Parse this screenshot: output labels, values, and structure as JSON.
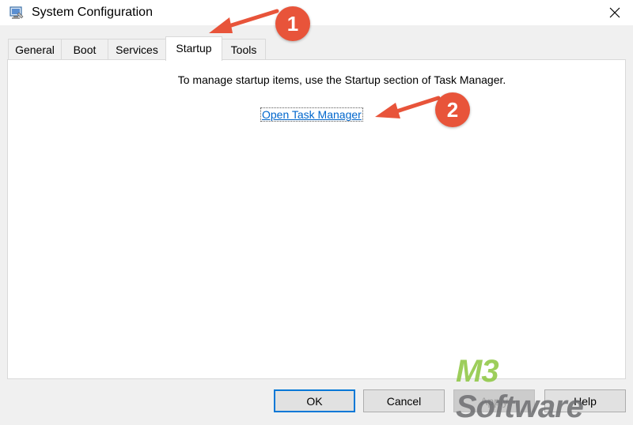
{
  "window": {
    "title": "System Configuration",
    "app_icon": "msconfig-icon",
    "close_icon": "close-icon"
  },
  "tabs": [
    {
      "label": "General",
      "active": false
    },
    {
      "label": "Boot",
      "active": false
    },
    {
      "label": "Services",
      "active": false
    },
    {
      "label": "Startup",
      "active": true
    },
    {
      "label": "Tools",
      "active": false
    }
  ],
  "startup": {
    "info_text": "To manage startup items, use the Startup section of Task Manager.",
    "link_text": "Open Task Manager"
  },
  "buttons": {
    "ok": "OK",
    "cancel": "Cancel",
    "apply": "Apply",
    "help": "Help"
  },
  "watermark": {
    "brand_a": "M3",
    "brand_b": " Software"
  },
  "annotations": {
    "badge_1": "1",
    "badge_2": "2",
    "color": "#e8543a"
  },
  "colors": {
    "link": "#0066cc",
    "default_button_border": "#0078d7",
    "watermark_green": "#8cc63f",
    "watermark_gray": "#6d6e71"
  }
}
